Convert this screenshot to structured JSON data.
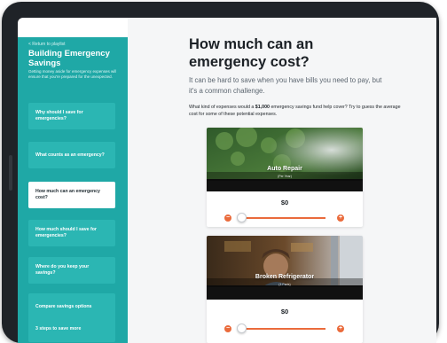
{
  "sidebar": {
    "back_label": "< Return to playlist",
    "title": "Building Emergency Savings",
    "description": "Getting money aside for emergency expenses will ensure that you're prepared for the unexpected.",
    "items": [
      {
        "label": "Why should I save for emergencies?"
      },
      {
        "label": "What counts as an emergency?"
      },
      {
        "label": "How much can an emergency cost?"
      },
      {
        "label": "How much should I save for emergencies?"
      },
      {
        "label": "Where do you keep your savings?"
      },
      {
        "label": "Compare savings options"
      },
      {
        "label": "3 steps to save more"
      }
    ]
  },
  "main": {
    "heading": "How much can an emergency cost?",
    "lead": "It can be hard to save when you have bills you need to pay, but it's a common challenge.",
    "question_before": "What kind of expenses would a ",
    "question_amount": "$1,000",
    "question_after": " emergency savings fund help cover? Try to guess the average cost for some of these potential expenses.",
    "cards": [
      {
        "title": "Auto Repair",
        "subtitle": "(Per Year)",
        "amount": "$0",
        "minus": "−",
        "plus": "+"
      },
      {
        "title": "Broken Refrigerator",
        "subtitle": "(1 Parts)",
        "amount": "$0",
        "minus": "−",
        "plus": "+"
      }
    ]
  },
  "colors": {
    "accent": "#ea6b3c",
    "sidebar": "#1fa8a6"
  }
}
